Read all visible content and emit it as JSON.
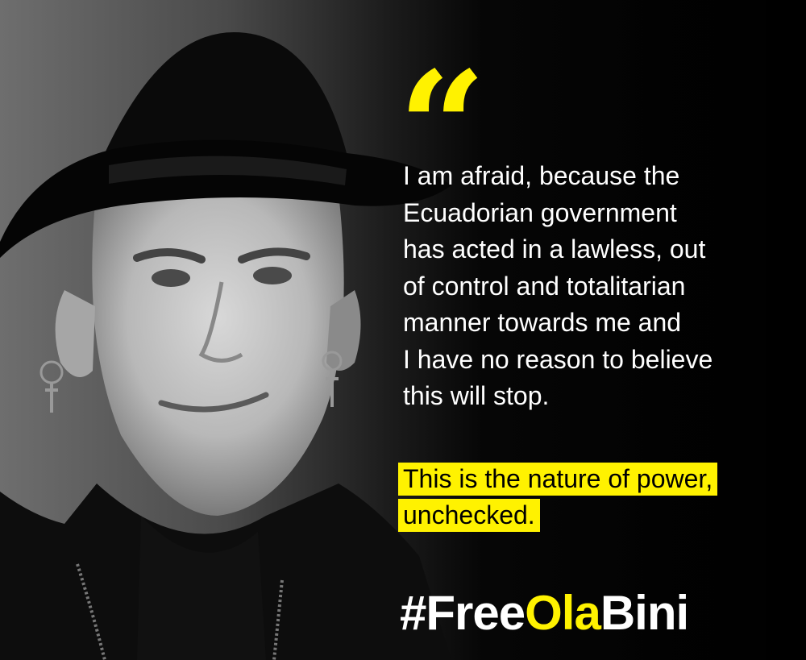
{
  "colors": {
    "accent": "#fff200",
    "text": "#ffffff",
    "background": "#000000"
  },
  "quote_mark": "“",
  "quote_text": "I am afraid, because the\nEcuadorian government\nhas acted in a lawless, out\nof control and totalitarian\nmanner towards me and\nI have no reason to believe\nthis will stop.",
  "highlight_lines": [
    "This is the nature of power,",
    "unchecked."
  ],
  "hashtag": {
    "part1": "#Free",
    "part2": "Ola",
    "part3": "Bini"
  }
}
